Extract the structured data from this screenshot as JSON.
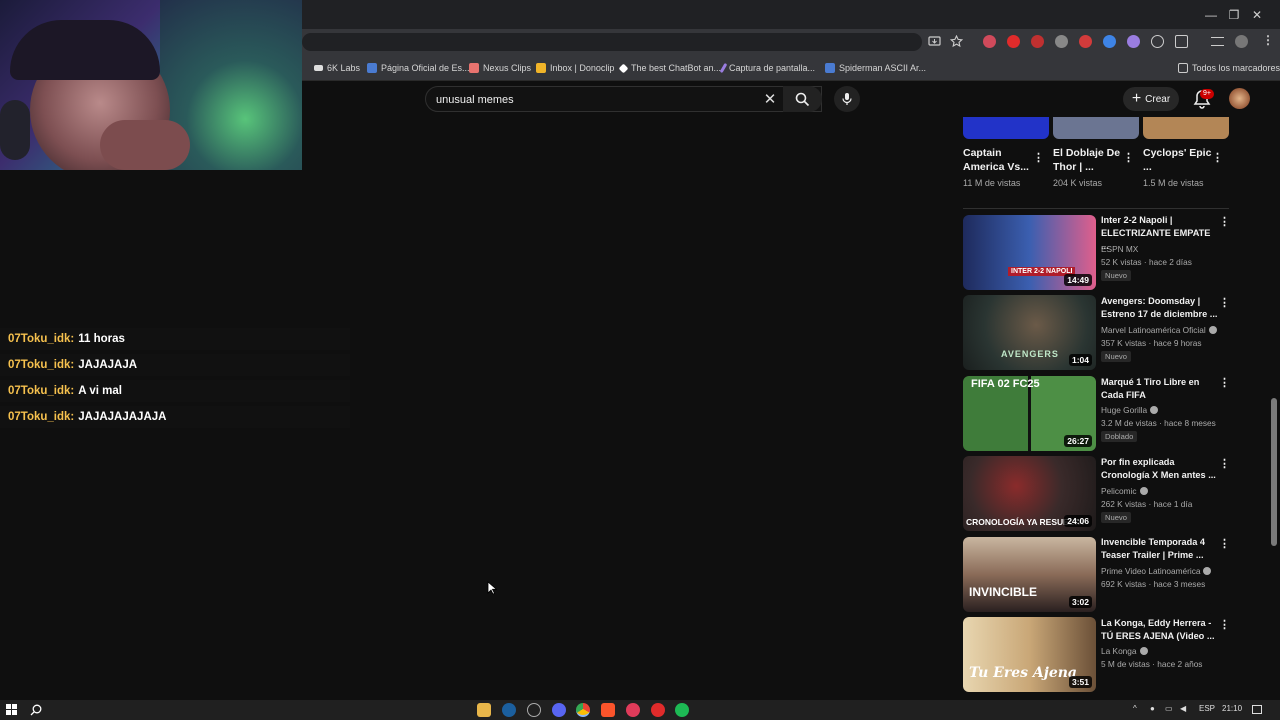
{
  "window": {
    "minimize": "—",
    "restore": "❐",
    "close": "✕"
  },
  "bookmarks": [
    {
      "label": "6K Labs",
      "color": "#ffffff"
    },
    {
      "label": "Página Oficial de Es...",
      "color": "#4a7bd1"
    },
    {
      "label": "Nexus Clips",
      "color": "#e8736f"
    },
    {
      "label": "Inbox | Donoclip",
      "color": "#f0b429"
    },
    {
      "label": "The best ChatBot an...",
      "color": "#ffffff"
    },
    {
      "label": "Captura de pantalla...",
      "color": "#9a7de0"
    },
    {
      "label": "Spiderman ASCII Ar...",
      "color": "#4a7bd1"
    }
  ],
  "all_bookmarks": "Todos los marcadores",
  "chat": [
    {
      "user": "07Toku_idk:",
      "msg": "11 horas"
    },
    {
      "user": "07Toku_idk:",
      "msg": "JAJAJAJA"
    },
    {
      "user": "07Toku_idk:",
      "msg": "A vi mal"
    },
    {
      "user": "07Toku_idk:",
      "msg": "JAJAJAJAJAJA"
    }
  ],
  "search": {
    "value": "unusual memes"
  },
  "header": {
    "create_label": "Crear",
    "notif_badge": "9+"
  },
  "shorts": [
    {
      "title": "Captain America Vs...",
      "views": "11 M de vistas",
      "color": "#2233c8"
    },
    {
      "title": "El Doblaje De Thor | ...",
      "views": "204 K vistas",
      "color": "#6b7592"
    },
    {
      "title": "Cyclops' Epic ...",
      "views": "1.5 M de vistas",
      "color": "#b38656"
    }
  ],
  "videos": [
    {
      "title": "Inter 2-2 Napoli | ELECTRIZANTE EMPATE ...",
      "channel": "ESPN MX",
      "verified": false,
      "meta": "52 K vistas · hace 2 días",
      "badge": "Nuevo",
      "duration": "14:49",
      "bg": "#2d3b6a",
      "thumb_text": "INTER 2-2 NAPOLI"
    },
    {
      "title": "Avengers: Doomsday | Estreno 17 de diciembre ...",
      "channel": "Marvel Latinoamérica Oficial",
      "verified": true,
      "meta": "357 K vistas · hace 9 horas",
      "badge": "Nuevo",
      "duration": "1:04",
      "bg": "#3e4744",
      "thumb_text": "AVENGERS"
    },
    {
      "title": "Marqué 1 Tiro Libre en Cada FIFA",
      "channel": "Huge Gorilla",
      "verified": true,
      "meta": "3.2 M de vistas · hace 8 meses",
      "badge": "Doblado",
      "duration": "26:27",
      "bg": "#3f7c3a",
      "thumb_text": "FIFA 02   FC25"
    },
    {
      "title": "Por fin explicada Cronología X Men antes ...",
      "channel": "Pelicomic",
      "verified": true,
      "meta": "262 K vistas · hace 1 día",
      "badge": "Nuevo",
      "duration": "24:06",
      "bg": "#5a3e3a",
      "thumb_text": "CRONOLOGÍA YA RESUELTA"
    },
    {
      "title": "Invencible Temporada 4 Teaser Trailer | Prime ...",
      "channel": "Prime Video Latinoamérica",
      "verified": true,
      "meta": "692 K vistas · hace 3 meses",
      "badge": "",
      "duration": "3:02",
      "bg": "#8a6b58",
      "thumb_text": "INVINCIBLE"
    },
    {
      "title": "La Konga, Eddy Herrera - TÚ ERES AJENA (Video ...",
      "channel": "La Konga",
      "verified": true,
      "meta": "5 M de vistas · hace 2 años",
      "badge": "",
      "duration": "3:51",
      "bg": "#c9a777",
      "thumb_text": "Tu Eres Ajena"
    }
  ],
  "tray": {
    "lang": "ESP",
    "time": "21:10"
  }
}
